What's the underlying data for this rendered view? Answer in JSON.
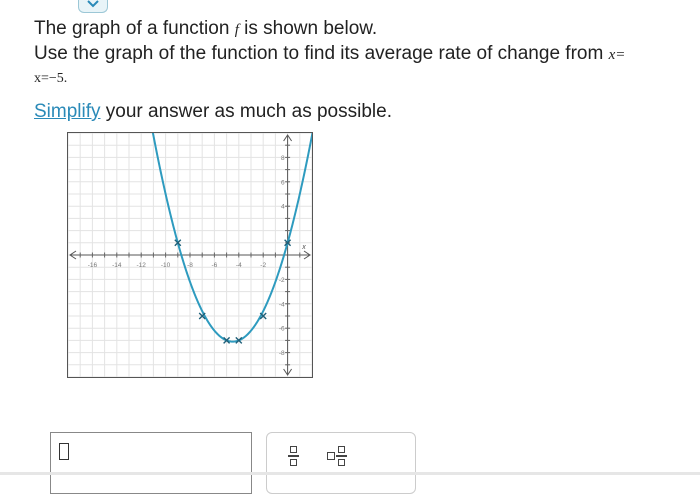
{
  "problem": {
    "line1_pre": "The graph of a function ",
    "line1_var": "f",
    "line1_post": " is shown below.",
    "line2_text": "Use the graph of the function to find its average rate of change from ",
    "line2_math": "x=",
    "line3_math": "x=−5.",
    "simplify_link": "Simplify",
    "simplify_rest": " your answer as much as possible."
  },
  "graph": {
    "x_axis_label": "x",
    "x_tick_labels": [
      "-16",
      "-14",
      "-12",
      "-10",
      "-8",
      "-6",
      "-4",
      "-2"
    ],
    "y_tick_labels": [
      "8",
      "6",
      "4",
      "-2",
      "-4",
      "-6",
      "-8"
    ],
    "xlim": [
      -18,
      2
    ],
    "ylim": [
      -10,
      10
    ],
    "curve_color": "#2e9bbf",
    "marked_points": [
      {
        "x": -9,
        "y": 1
      },
      {
        "x": -7,
        "y": -5
      },
      {
        "x": -5,
        "y": -7
      },
      {
        "x": -4,
        "y": -7
      },
      {
        "x": -2,
        "y": -5
      },
      {
        "x": 0,
        "y": 1
      }
    ]
  },
  "answer": {
    "input_value": ""
  },
  "tools": {
    "fraction_icon": "fraction-icon",
    "mixed_number_icon": "mixed-number-icon"
  }
}
